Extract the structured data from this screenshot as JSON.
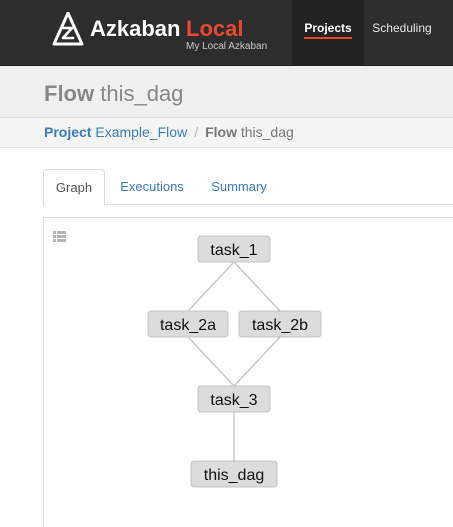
{
  "brand": {
    "name": "Azkaban",
    "env": "Local",
    "subtitle": "My Local Azkaban"
  },
  "nav": {
    "projects": "Projects",
    "scheduling": "Scheduling"
  },
  "header": {
    "keyword": "Flow",
    "name": "this_dag"
  },
  "breadcrumb": {
    "project_label": "Project",
    "project_name": "Example_Flow",
    "separator": "/",
    "flow_label": "Flow",
    "flow_name": "this_dag"
  },
  "tabs": [
    {
      "label": "Graph",
      "active": true
    },
    {
      "label": "Executions",
      "active": false
    },
    {
      "label": "Summary",
      "active": false
    }
  ],
  "graph": {
    "nodes": [
      {
        "id": "task_1",
        "label": "task_1"
      },
      {
        "id": "task_2a",
        "label": "task_2a"
      },
      {
        "id": "task_2b",
        "label": "task_2b"
      },
      {
        "id": "task_3",
        "label": "task_3"
      },
      {
        "id": "this_dag",
        "label": "this_dag"
      }
    ],
    "edges": [
      [
        "task_1",
        "task_2a"
      ],
      [
        "task_1",
        "task_2b"
      ],
      [
        "task_2a",
        "task_3"
      ],
      [
        "task_2b",
        "task_3"
      ],
      [
        "task_3",
        "this_dag"
      ]
    ]
  },
  "colors": {
    "navbar": "#2d2d2d",
    "accent": "#e8492e",
    "link": "#3b7bbf",
    "node_fill": "#dcdcdc"
  },
  "icons": {
    "logo": "azkaban-logo-icon",
    "list_toggle": "list-icon"
  }
}
